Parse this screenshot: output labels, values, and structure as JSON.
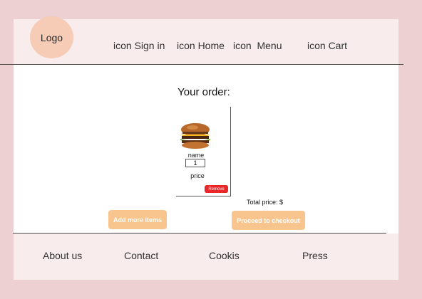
{
  "header": {
    "logo": "Logo",
    "nav": [
      {
        "label": "icon Sign in"
      },
      {
        "label": "icon Home"
      },
      {
        "label": "icon  Menu"
      },
      {
        "label": "icon Cart"
      }
    ]
  },
  "order": {
    "title": "Your order:",
    "item": {
      "name": "name",
      "quantity": "1",
      "price": "price",
      "remove_label": "Remove",
      "image_icon": "burger-icon"
    },
    "total_label": "Total price: $",
    "add_more_label": "Add more items",
    "checkout_label": "Proceed to checkout"
  },
  "footer": {
    "links": [
      {
        "label": "About us"
      },
      {
        "label": "Contact"
      },
      {
        "label": "Cookis"
      },
      {
        "label": "Press"
      }
    ]
  },
  "colors": {
    "page_background": "#ecd0d2",
    "header_background": "#f9ecec",
    "logo_circle": "#f6ccb6",
    "button_accent": "#f7c58d",
    "remove_button": "#e9262a"
  }
}
